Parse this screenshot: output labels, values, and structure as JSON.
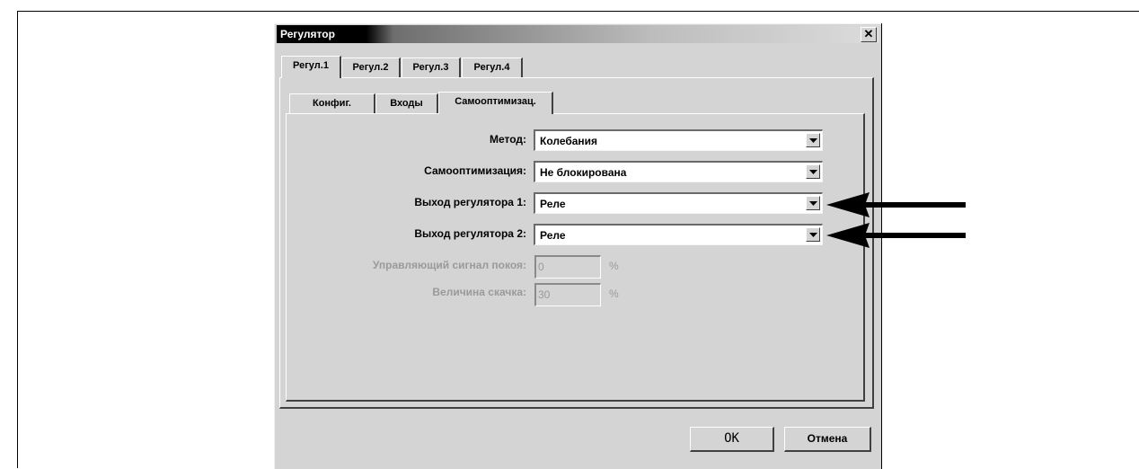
{
  "window": {
    "title": "Регулятор",
    "close_glyph": "✕"
  },
  "outer_tabs": [
    {
      "label": "Регул.1",
      "active": true
    },
    {
      "label": "Регул.2",
      "active": false
    },
    {
      "label": "Регул.3",
      "active": false
    },
    {
      "label": "Регул.4",
      "active": false
    }
  ],
  "inner_tabs": [
    {
      "label": "Конфиг.",
      "active": false
    },
    {
      "label": "Входы",
      "active": false
    },
    {
      "label": "Самооптимизац.",
      "active": true
    }
  ],
  "form": {
    "method": {
      "label": "Метод:",
      "value": "Колебания"
    },
    "selfopt": {
      "label": "Самооптимизация:",
      "value": "Не блокирована"
    },
    "out1": {
      "label": "Выход регулятора 1:",
      "value": "Реле"
    },
    "out2": {
      "label": "Выход регулятора 2:",
      "value": "Реле"
    },
    "idle_signal": {
      "label": "Управляющий сигнал покоя:",
      "value": "0",
      "unit": "%"
    },
    "step_size": {
      "label": "Величина скачка:",
      "value": "30",
      "unit": "%"
    }
  },
  "buttons": {
    "ok": "OK",
    "cancel": "Отмена"
  },
  "colors": {
    "dialog_bg": "#d4d4d4",
    "disabled_text": "#9a9a9a",
    "arrow": "#000000"
  },
  "icons": {
    "combo_dropdown": "chevron-down-icon",
    "annotation": "arrow-left-icon"
  }
}
